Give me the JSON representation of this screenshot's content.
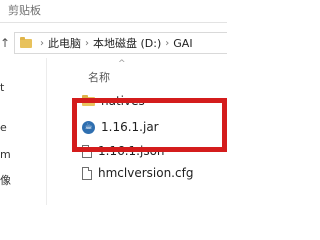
{
  "ribbon": {
    "clipboard_label": "剪贴板"
  },
  "addressbar": {
    "crumbs": [
      "此电脑",
      "本地磁盘 (D:)",
      "GAI"
    ]
  },
  "file_list": {
    "column_name": "名称",
    "items": [
      {
        "name": "natives",
        "type": "folder"
      },
      {
        "name": "1.16.1.jar",
        "type": "jar"
      },
      {
        "name": "1.16.1.json",
        "type": "file"
      },
      {
        "name": "hmclversion.cfg",
        "type": "file"
      }
    ]
  },
  "sidebar": {
    "fragments": [
      "t",
      "e",
      "m",
      "像"
    ]
  },
  "highlight": {
    "color": "#d41c1c",
    "target": "1.16.1.jar"
  }
}
